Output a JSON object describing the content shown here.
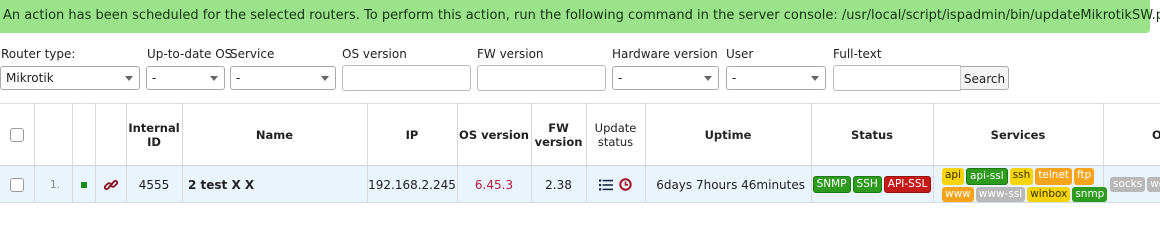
{
  "banner": {
    "message": "An action has been scheduled for the selected routers. To perform this action, run the following command in the server console: /usr/local/script/ispadmin/bin/updateMikrotikSW.pl"
  },
  "filters": {
    "router_type_label": "Router type:",
    "router_type_value": "Mikrotik",
    "uptodate_label": "Up-to-date OS",
    "uptodate_value": "-",
    "service_label": "Service",
    "service_value": "-",
    "os_version_label": "OS version",
    "fw_version_label": "FW version",
    "hardware_label": "Hardware version",
    "hardware_value": "-",
    "user_label": "User",
    "user_value": "-",
    "fulltext_label": "Full-text",
    "search_button": "Search"
  },
  "table": {
    "headers": {
      "internal_id": "Internal ID",
      "name": "Name",
      "ip": "IP",
      "os_version": "OS version",
      "fw_version": "FW version",
      "update_status": "Update status",
      "uptime": "Uptime",
      "status": "Status",
      "services": "Services",
      "other": "O"
    },
    "rows": [
      {
        "index": "1.",
        "internal_id": "4555",
        "name": "2 test X X",
        "ip": "192.168.2.245",
        "os_version": "6.45.3",
        "fw_version": "2.38",
        "uptime": "6days 7hours 46minutes",
        "status_badges": [
          "SNMP",
          "SSH",
          "API-SSL"
        ],
        "services_row1": [
          "api",
          "api-ssl",
          "ssh",
          "telnet",
          "ftp"
        ],
        "services_row2": [
          "www",
          "www-ssl",
          "winbox",
          "snmp"
        ],
        "other_badges": [
          "socks",
          "we"
        ]
      }
    ]
  },
  "colors": {
    "banner_bg": "#9be38a",
    "row_bg": "#e9f4fc",
    "os_version_text": "#b0203a",
    "badge_green": "#2e9a1e",
    "badge_red": "#c41a1a",
    "badge_yellow": "#f5d40a",
    "badge_orange": "#f5a41a",
    "badge_gray": "#b8b8b8"
  }
}
